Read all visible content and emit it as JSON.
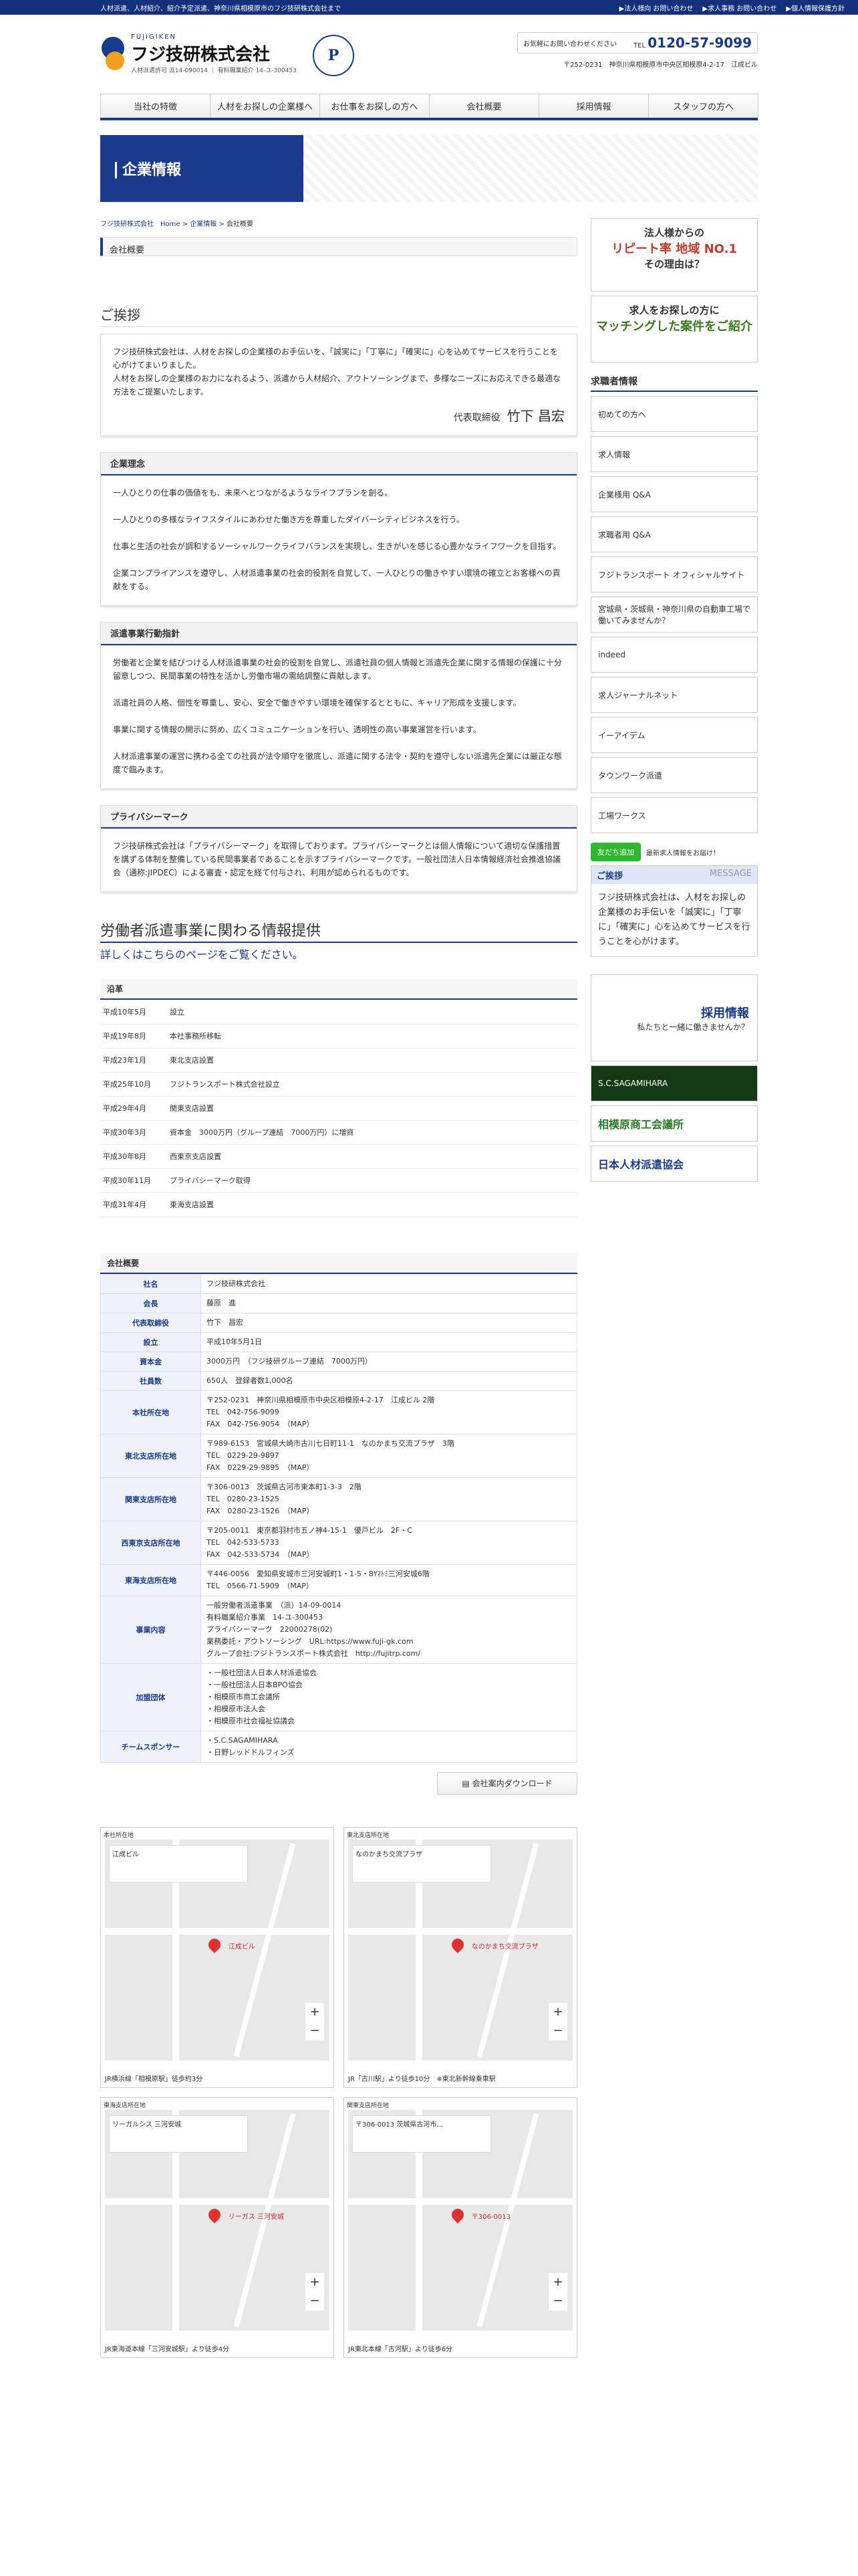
{
  "topbar": {
    "left": "人材派遣、人材紹介、紹介予定派遣、神奈川県相模原市のフジ技研株式会社まで",
    "links": [
      "▶法人様向 お問い合わせ",
      "▶求人事務 お問い合わせ",
      "▶個人情報保護方針"
    ]
  },
  "header": {
    "logo_small": "FUJIGIKEN",
    "logo_name": "フジ技研株式会社",
    "license": "人材派遣許可 派14-090014 ｜ 有料職業紹介 14-ユ-300453",
    "pmark": "P",
    "contact_label": "お気軽にお問い合わせください",
    "tel_prefix": "TEL",
    "tel": "0120-57-9099",
    "address": "〒252-0231　神奈川県相模原市中央区相模原4-2-17　江成ビル"
  },
  "nav": [
    "当社の特徴",
    "人材をお探しの企業様へ",
    "お仕事をお探しの方へ",
    "会社概要",
    "採用情報",
    "スタッフの方へ"
  ],
  "banner": {
    "title": "企業情報"
  },
  "breadcrumb": {
    "home": "フジ技研株式会社　Home",
    "parent": "企業情報",
    "current": "会社概要"
  },
  "section_title": "会社概要",
  "greeting": {
    "heading": "ご挨拶",
    "text1": "フジ技研株式会社は、人材をお探しの企業様のお手伝いを、「誠実に」「丁寧に」「確実に」心を込めてサービスを行うことを心がけてまいりました。",
    "text2": "人材をお探しの企業様のお力になれるよう、派遣から人材紹介、アウトソーシングまで、多様なニーズにお応えできる最適な方法をご提案いたします。",
    "sig_title": "代表取締役",
    "sig_name": "竹下 昌宏"
  },
  "rinen": {
    "title": "企業理念",
    "paras": [
      "一人ひとりの仕事の価値をも、未来へとつながるようなライフプランを創る。",
      "一人ひとりの多様なライフスタイルにあわせた働き方を尊重したダイバーシティビジネスを行う。",
      "仕事と生活の社会が調和するソーシャルワークライフバランスを実現し、生きがいを感じる心豊かなライフワークを目指す。",
      "企業コンプライアンスを遵守し、人材派遣事業の社会的役割を自覚して、一人ひとりの働きやすい環境の確立とお客様への貢献をする。"
    ]
  },
  "koudou": {
    "title": "派遣事業行動指針",
    "paras": [
      "労働者と企業を結びつける人材派遣事業の社会的役割を自覚し、派遣社員の個人情報と派遣先企業に関する情報の保護に十分留意しつつ、民間事業の特性を活かし労働市場の需給調整に貢献します。",
      "派遣社員の人格、個性を尊重し、安心、安全で働きやすい環境を確保するとともに、キャリア形成を支援します。",
      "事業に関する情報の開示に努め、広くコミュニケーションを行い、透明性の高い事業運営を行います。",
      "人材派遣事業の運営に携わる全ての社員が法令順守を徹底し、派遣に関する法令・契約を遵守しない派遣先企業には厳正な態度で臨みます。"
    ]
  },
  "privacy": {
    "title": "プライバシーマーク",
    "paras": [
      "フジ技研株式会社は「プライバシーマーク」を取得しております。プライバシーマークとは個人情報について適切な保護措置を講ずる体制を整備している民間事業者であることを示すプライバシーマークです。一般社団法人日本情報経済社会推進協議会（通称:JIPDEC）による審査・認定を経て付与され、利用が認められるものです。"
    ]
  },
  "labor": {
    "heading": "労働者派遣事業に関わる情報提供",
    "link": "詳しくはこちらのページをご覧ください。"
  },
  "history": {
    "title": "沿革",
    "rows": [
      [
        "平成10年5月",
        "設立"
      ],
      [
        "平成19年8月",
        "本社事務所移転"
      ],
      [
        "平成23年1月",
        "東北支店設置"
      ],
      [
        "平成25年10月",
        "フジトランスポート株式会社設立"
      ],
      [
        "平成29年4月",
        "関東支店設置"
      ],
      [
        "平成30年3月",
        "資本金　3000万円（グループ連結　7000万円）に増資"
      ],
      [
        "平成30年8月",
        "西東京支店設置"
      ],
      [
        "平成30年11月",
        "プライバシーマーク取得"
      ],
      [
        "平成31年4月",
        "東海支店設置"
      ]
    ]
  },
  "company": {
    "title": "会社概要",
    "rows": [
      {
        "k": "社名",
        "v": [
          "フジ技研株式会社"
        ]
      },
      {
        "k": "会長",
        "v": [
          "藤原　進"
        ]
      },
      {
        "k": "代表取締役",
        "v": [
          "竹下　昌宏"
        ]
      },
      {
        "k": "設立",
        "v": [
          "平成10年5月1日"
        ]
      },
      {
        "k": "資本金",
        "v": [
          "3000万円　（フジ技研グループ連結　7000万円）"
        ]
      },
      {
        "k": "社員数",
        "v": [
          "650人　登録者数1,000名"
        ]
      },
      {
        "k": "本社所在地",
        "v": [
          "〒252-0231　神奈川県相模原市中央区相模原4-2-17　江成ビル 2階",
          "TEL　042-756-9099",
          "FAX　042-756-9054　（MAP）"
        ]
      },
      {
        "k": "東北支店所在地",
        "v": [
          "〒989-6153　宮城県大崎市古川七日町11-1　なのかまち交流プラザ　3階",
          "TEL　0229-29-9897",
          "FAX　0229-29-9895　（MAP）"
        ]
      },
      {
        "k": "関東支店所在地",
        "v": [
          "〒306-0013　茨城県古河市東本町1-3-3　2階",
          "TEL　0280-23-1525",
          "FAX　0280-23-1526　（MAP）"
        ]
      },
      {
        "k": "西東京支店所在地",
        "v": [
          "〒205-0011　東京都羽村市五ノ神4-15-1　優戸ビル　2F・C",
          "TEL　042-533-5733",
          "FAX　042-533-5734　（MAP）"
        ]
      },
      {
        "k": "東海支店所在地",
        "v": [
          "〒446-0056　愛知県安城市三河安城町1・1-5・8ﾔﾏﾄﾐ三河安城6階",
          "TEL　0566-71-5909　（MAP）"
        ]
      },
      {
        "k": "事業内容",
        "v": [
          "一般労働者派遣事業　（派）14-09-0014",
          "有料職業紹介事業　14-ユ-300453",
          "プライバシーマーク　22000278(02)",
          "業務委託・アウトソーシング　URL:https://www.fuji-gk.com",
          "グループ会社:フジトランスポート株式会社　http://fujitrp.com/"
        ]
      },
      {
        "k": "加盟団体",
        "v": [
          "・一般社団法人日本人材派遣協会",
          "・一般社団法人日本BPO協会",
          "・相模原市商工会議所",
          "・相模原市法人会",
          "・相模原市社会福祉協議会"
        ]
      },
      {
        "k": "チームスポンサー",
        "v": [
          "・S.C.SAGAMIHARA",
          "・日野レッドドルフィンズ"
        ]
      }
    ]
  },
  "download": "会社案内ダウンロード",
  "maps": [
    {
      "label": "本社所在地",
      "info": "江成ビル",
      "place": "江成ビル",
      "caption": "JR横浜線「相模原駅」徒歩約3分"
    },
    {
      "label": "東北支店所在地",
      "info": "なのかまち交流プラザ",
      "place": "なのかまち交流プラザ",
      "caption": "JR「古川駅」より徒歩10分　※東北新幹線乗車駅"
    },
    {
      "label": "東海支店所在地",
      "info": "リーガルシス 三河安城",
      "place": "リーガス 三河安城",
      "caption": "JR東海道本線「三河安城駅」より徒歩4分"
    },
    {
      "label": "関東支店所在地",
      "info": "〒306-0013 茨城県古河市...",
      "place": "〒306-0013",
      "caption": "JR東北本線「古河駅」より徒歩6分"
    }
  ],
  "side": {
    "banner1_top": "法人様からの",
    "banner1_mid": "リピート率 地域 NO.1",
    "banner1_bot": "その理由は？",
    "banner2_top": "求人をお探しの方に",
    "banner2_mid": "マッチングした案件をご紹介",
    "kyujin_head": "求職者情報",
    "items": [
      "初めての方へ",
      "求人情報",
      "企業様用 Q&A",
      "求職者用 Q&A",
      "フジトランスポート オフィシャルサイト",
      "宮城県・茨城県・神奈川県の自動車工場で働いてみませんか？",
      "indeed",
      "求人ジャーナルネット",
      "イーアイデム",
      "タウンワーク派遣",
      "工場ワークス"
    ],
    "line_btn": "友だち追加",
    "line_txt": "最新求人情報をお届け！",
    "msg_head": "ご挨拶",
    "msg_sub": "MESSAGE",
    "msg_body": "フジ技研株式会社は、人材をお探しの企業様のお手伝いを「誠実に」「丁寧に」「確実に」心を込めてサービスを行うことを心がけます。",
    "recruit": "採用情報",
    "recruit_sub": "私たちと一緒に働きませんか？",
    "sponsor1": "S.C.SAGAMIHARA",
    "sponsor2": "相模原商工会議所",
    "sponsor3": "日本人材派遣協会"
  }
}
